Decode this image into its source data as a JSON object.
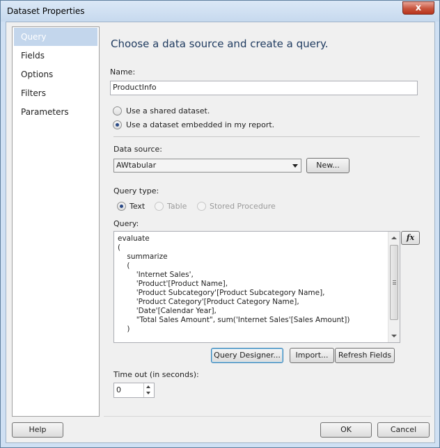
{
  "window": {
    "title": "Dataset Properties",
    "close_glyph": "x"
  },
  "nav": {
    "items": [
      "Query",
      "Fields",
      "Options",
      "Filters",
      "Parameters"
    ],
    "selected": "Query"
  },
  "main": {
    "heading": "Choose a data source and create a query.",
    "name_label": "Name:",
    "name_value": "ProductInfo",
    "dataset_options": [
      "Use a shared dataset.",
      "Use a dataset embedded in my report."
    ],
    "dataset_selected": "Use a dataset embedded in my report.",
    "datasource_label": "Data source:",
    "datasource_value": "AWtabular",
    "new_button": "New...",
    "querytype_label": "Query type:",
    "querytype_options": [
      {
        "label": "Text",
        "enabled": true,
        "checked": true
      },
      {
        "label": "Table",
        "enabled": false,
        "checked": false
      },
      {
        "label": "Stored Procedure",
        "enabled": false,
        "checked": false
      }
    ],
    "query_label": "Query:",
    "query_lines": [
      "evaluate",
      "(",
      "    summarize",
      "    (",
      "        'Internet Sales',",
      "        'Product'[Product Name],",
      "        'Product Subcategory'[Product Subcategory Name],",
      "        'Product Category'[Product Category Name],",
      "        'Date'[Calendar Year],",
      "        \"Total Sales Amount\", sum('Internet Sales'[Sales Amount])",
      "    )"
    ],
    "fx_button": "fx",
    "query_designer_button": "Query Designer...",
    "import_button": "Import...",
    "refresh_button": "Refresh Fields",
    "timeout_label": "Time out (in seconds):",
    "timeout_value": "0"
  },
  "footer": {
    "help": "Help",
    "ok": "OK",
    "cancel": "Cancel"
  }
}
